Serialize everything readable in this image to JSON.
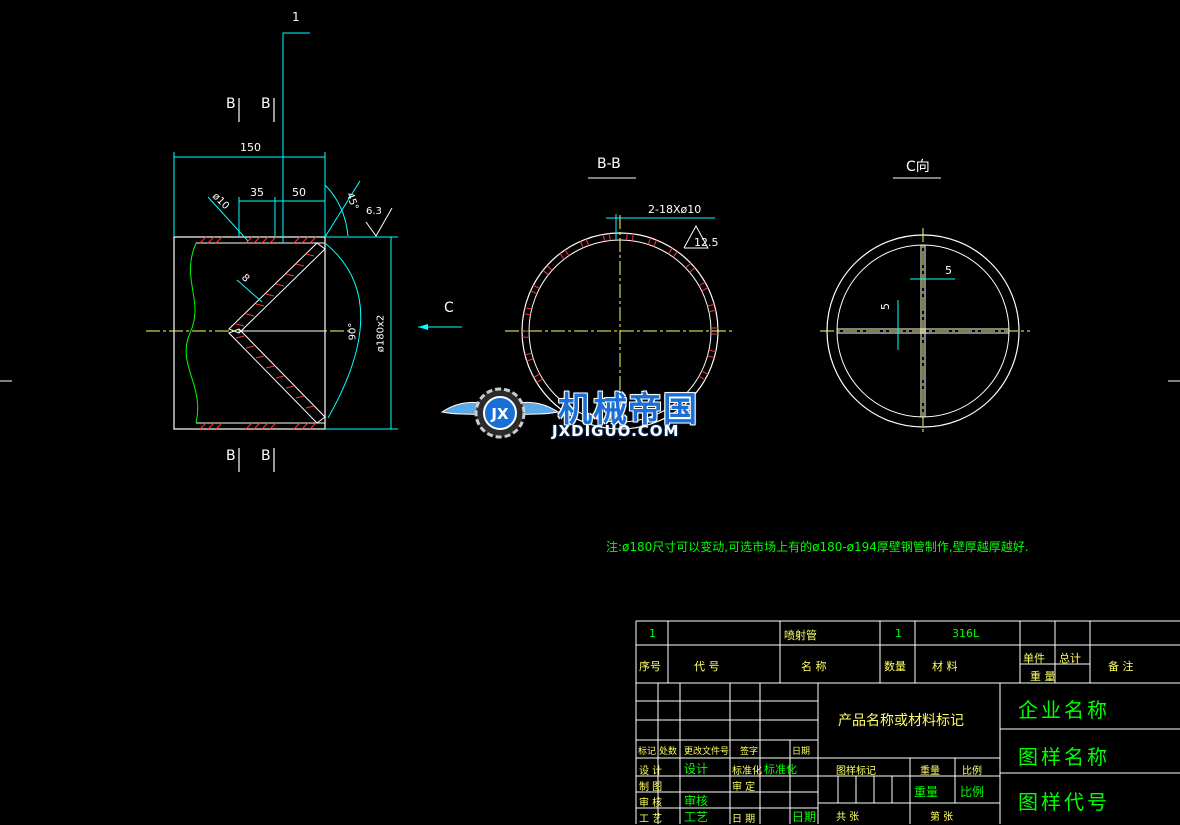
{
  "views": {
    "section_mark_1": "1",
    "section_b": "B",
    "dim_150": "150",
    "dim_35": "35",
    "dim_50": "50",
    "dim_phi10": "ø10",
    "dim_45deg": "45°",
    "dim_roughness": "6.3",
    "dim_8": "8",
    "dim_90deg": "90°",
    "dim_phi180": "ø180x2",
    "arrow_c": "C",
    "bb_title": "B-B",
    "bb_holes": "2-18Xø10",
    "bb_roughness": "12.5",
    "c_title": "C向",
    "c_dim_5a": "5",
    "c_dim_5b": "5"
  },
  "watermark": {
    "title": "机械帝国",
    "url": "JXDIGUO.COM",
    "logo_mark": "JX"
  },
  "note": "注:ø180尺寸可以变动,可选市场上有的ø180-ø194厚壁钢管制作,壁厚越厚越好.",
  "title_block": {
    "row1": {
      "no": "1",
      "name": "喷射管",
      "qty": "1",
      "material": "316L"
    },
    "headers": {
      "no": "序号",
      "code": "代    号",
      "name": "名    称",
      "qty": "数量",
      "material": "材    料",
      "unit": "单件",
      "total": "总计",
      "weight": "重    量",
      "remark": "备    注"
    },
    "product": "产品名称或材料标记",
    "company": "企业名称",
    "drawing_name": "图样名称",
    "drawing_code": "图样代号",
    "sign_headers": [
      "标记",
      "处数",
      "更改文件号",
      "签字",
      "日期"
    ],
    "design": "设 计",
    "design_sig": "设计",
    "standard": "标准化",
    "standard_sig": "标准化",
    "draw": "制 图",
    "approve": "审 定",
    "check": "审 核",
    "check_sig": "审核",
    "process": "工 艺",
    "process_sig": "工艺",
    "date": "日 期",
    "date_sig": "日期",
    "mark_label": "图样标记",
    "weight_label": "重量",
    "scale_label": "比例",
    "weight_val": "重量",
    "scale_val": "比例",
    "sheets_total": "共 张",
    "sheet_no": "第 张"
  }
}
